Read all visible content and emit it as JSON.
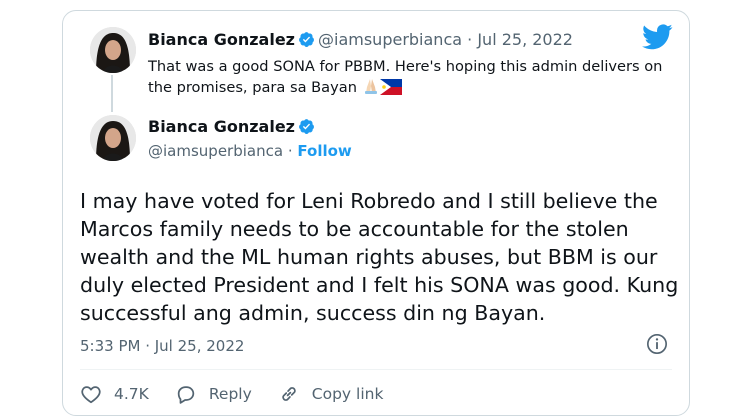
{
  "quoted_tweet": {
    "name": "Bianca Gonzalez",
    "handle": "@iamsuperbianca",
    "separator": "·",
    "date": "Jul 25, 2022",
    "text": "That was a good SONA for PBBM. Here's hoping this admin delivers on the promises, para sa Bayan"
  },
  "main_tweet": {
    "name": "Bianca Gonzalez",
    "handle": "@iamsuperbianca",
    "separator": "·",
    "follow_label": "Follow",
    "text": "I may have voted for Leni Robredo and I still believe the Marcos family needs to be accountable for the stolen wealth and the ML human rights abuses, but BBM is our duly elected President and I felt his SONA was good. Kung successful ang admin, success din ng Bayan.",
    "timestamp": "5:33 PM · Jul 25, 2022"
  },
  "actions": {
    "like_count": "4.7K",
    "reply_label": "Reply",
    "copy_link_label": "Copy link"
  },
  "icons": {
    "brand": "twitter-bird-icon",
    "verified": "verified-badge-icon",
    "like": "heart-icon",
    "reply": "speech-bubble-icon",
    "copy_link": "link-icon",
    "info": "info-icon",
    "emoji_1": "folded-hands-emoji",
    "emoji_2": "philippines-flag-emoji"
  },
  "colors": {
    "accent": "#1d9bf0",
    "text": "#0f1419",
    "muted": "#536471",
    "border": "#cfd9de"
  }
}
